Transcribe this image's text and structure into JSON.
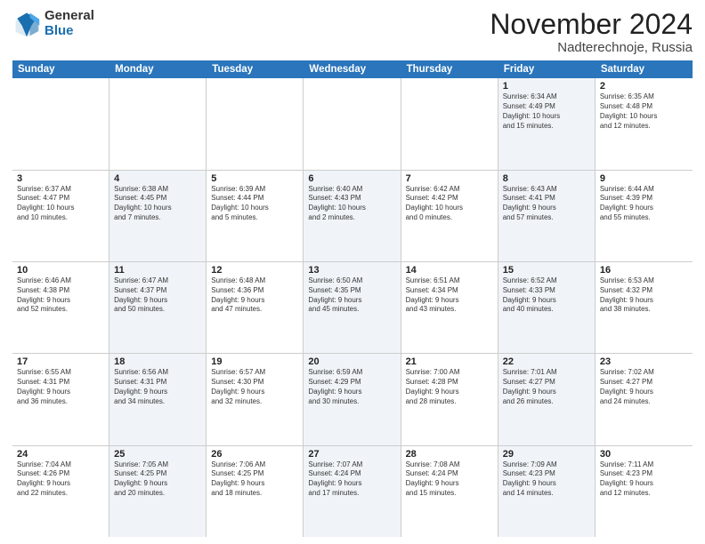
{
  "logo": {
    "general": "General",
    "blue": "Blue"
  },
  "title": "November 2024",
  "location": "Nadterechnoje, Russia",
  "days_of_week": [
    "Sunday",
    "Monday",
    "Tuesday",
    "Wednesday",
    "Thursday",
    "Friday",
    "Saturday"
  ],
  "weeks": [
    [
      {
        "day": "",
        "info": "",
        "shaded": false
      },
      {
        "day": "",
        "info": "",
        "shaded": false
      },
      {
        "day": "",
        "info": "",
        "shaded": false
      },
      {
        "day": "",
        "info": "",
        "shaded": false
      },
      {
        "day": "",
        "info": "",
        "shaded": false
      },
      {
        "day": "1",
        "info": "Sunrise: 6:34 AM\nSunset: 4:49 PM\nDaylight: 10 hours\nand 15 minutes.",
        "shaded": true
      },
      {
        "day": "2",
        "info": "Sunrise: 6:35 AM\nSunset: 4:48 PM\nDaylight: 10 hours\nand 12 minutes.",
        "shaded": false
      }
    ],
    [
      {
        "day": "3",
        "info": "Sunrise: 6:37 AM\nSunset: 4:47 PM\nDaylight: 10 hours\nand 10 minutes.",
        "shaded": false
      },
      {
        "day": "4",
        "info": "Sunrise: 6:38 AM\nSunset: 4:45 PM\nDaylight: 10 hours\nand 7 minutes.",
        "shaded": true
      },
      {
        "day": "5",
        "info": "Sunrise: 6:39 AM\nSunset: 4:44 PM\nDaylight: 10 hours\nand 5 minutes.",
        "shaded": false
      },
      {
        "day": "6",
        "info": "Sunrise: 6:40 AM\nSunset: 4:43 PM\nDaylight: 10 hours\nand 2 minutes.",
        "shaded": true
      },
      {
        "day": "7",
        "info": "Sunrise: 6:42 AM\nSunset: 4:42 PM\nDaylight: 10 hours\nand 0 minutes.",
        "shaded": false
      },
      {
        "day": "8",
        "info": "Sunrise: 6:43 AM\nSunset: 4:41 PM\nDaylight: 9 hours\nand 57 minutes.",
        "shaded": true
      },
      {
        "day": "9",
        "info": "Sunrise: 6:44 AM\nSunset: 4:39 PM\nDaylight: 9 hours\nand 55 minutes.",
        "shaded": false
      }
    ],
    [
      {
        "day": "10",
        "info": "Sunrise: 6:46 AM\nSunset: 4:38 PM\nDaylight: 9 hours\nand 52 minutes.",
        "shaded": false
      },
      {
        "day": "11",
        "info": "Sunrise: 6:47 AM\nSunset: 4:37 PM\nDaylight: 9 hours\nand 50 minutes.",
        "shaded": true
      },
      {
        "day": "12",
        "info": "Sunrise: 6:48 AM\nSunset: 4:36 PM\nDaylight: 9 hours\nand 47 minutes.",
        "shaded": false
      },
      {
        "day": "13",
        "info": "Sunrise: 6:50 AM\nSunset: 4:35 PM\nDaylight: 9 hours\nand 45 minutes.",
        "shaded": true
      },
      {
        "day": "14",
        "info": "Sunrise: 6:51 AM\nSunset: 4:34 PM\nDaylight: 9 hours\nand 43 minutes.",
        "shaded": false
      },
      {
        "day": "15",
        "info": "Sunrise: 6:52 AM\nSunset: 4:33 PM\nDaylight: 9 hours\nand 40 minutes.",
        "shaded": true
      },
      {
        "day": "16",
        "info": "Sunrise: 6:53 AM\nSunset: 4:32 PM\nDaylight: 9 hours\nand 38 minutes.",
        "shaded": false
      }
    ],
    [
      {
        "day": "17",
        "info": "Sunrise: 6:55 AM\nSunset: 4:31 PM\nDaylight: 9 hours\nand 36 minutes.",
        "shaded": false
      },
      {
        "day": "18",
        "info": "Sunrise: 6:56 AM\nSunset: 4:31 PM\nDaylight: 9 hours\nand 34 minutes.",
        "shaded": true
      },
      {
        "day": "19",
        "info": "Sunrise: 6:57 AM\nSunset: 4:30 PM\nDaylight: 9 hours\nand 32 minutes.",
        "shaded": false
      },
      {
        "day": "20",
        "info": "Sunrise: 6:59 AM\nSunset: 4:29 PM\nDaylight: 9 hours\nand 30 minutes.",
        "shaded": true
      },
      {
        "day": "21",
        "info": "Sunrise: 7:00 AM\nSunset: 4:28 PM\nDaylight: 9 hours\nand 28 minutes.",
        "shaded": false
      },
      {
        "day": "22",
        "info": "Sunrise: 7:01 AM\nSunset: 4:27 PM\nDaylight: 9 hours\nand 26 minutes.",
        "shaded": true
      },
      {
        "day": "23",
        "info": "Sunrise: 7:02 AM\nSunset: 4:27 PM\nDaylight: 9 hours\nand 24 minutes.",
        "shaded": false
      }
    ],
    [
      {
        "day": "24",
        "info": "Sunrise: 7:04 AM\nSunset: 4:26 PM\nDaylight: 9 hours\nand 22 minutes.",
        "shaded": false
      },
      {
        "day": "25",
        "info": "Sunrise: 7:05 AM\nSunset: 4:25 PM\nDaylight: 9 hours\nand 20 minutes.",
        "shaded": true
      },
      {
        "day": "26",
        "info": "Sunrise: 7:06 AM\nSunset: 4:25 PM\nDaylight: 9 hours\nand 18 minutes.",
        "shaded": false
      },
      {
        "day": "27",
        "info": "Sunrise: 7:07 AM\nSunset: 4:24 PM\nDaylight: 9 hours\nand 17 minutes.",
        "shaded": true
      },
      {
        "day": "28",
        "info": "Sunrise: 7:08 AM\nSunset: 4:24 PM\nDaylight: 9 hours\nand 15 minutes.",
        "shaded": false
      },
      {
        "day": "29",
        "info": "Sunrise: 7:09 AM\nSunset: 4:23 PM\nDaylight: 9 hours\nand 14 minutes.",
        "shaded": true
      },
      {
        "day": "30",
        "info": "Sunrise: 7:11 AM\nSunset: 4:23 PM\nDaylight: 9 hours\nand 12 minutes.",
        "shaded": false
      }
    ]
  ]
}
